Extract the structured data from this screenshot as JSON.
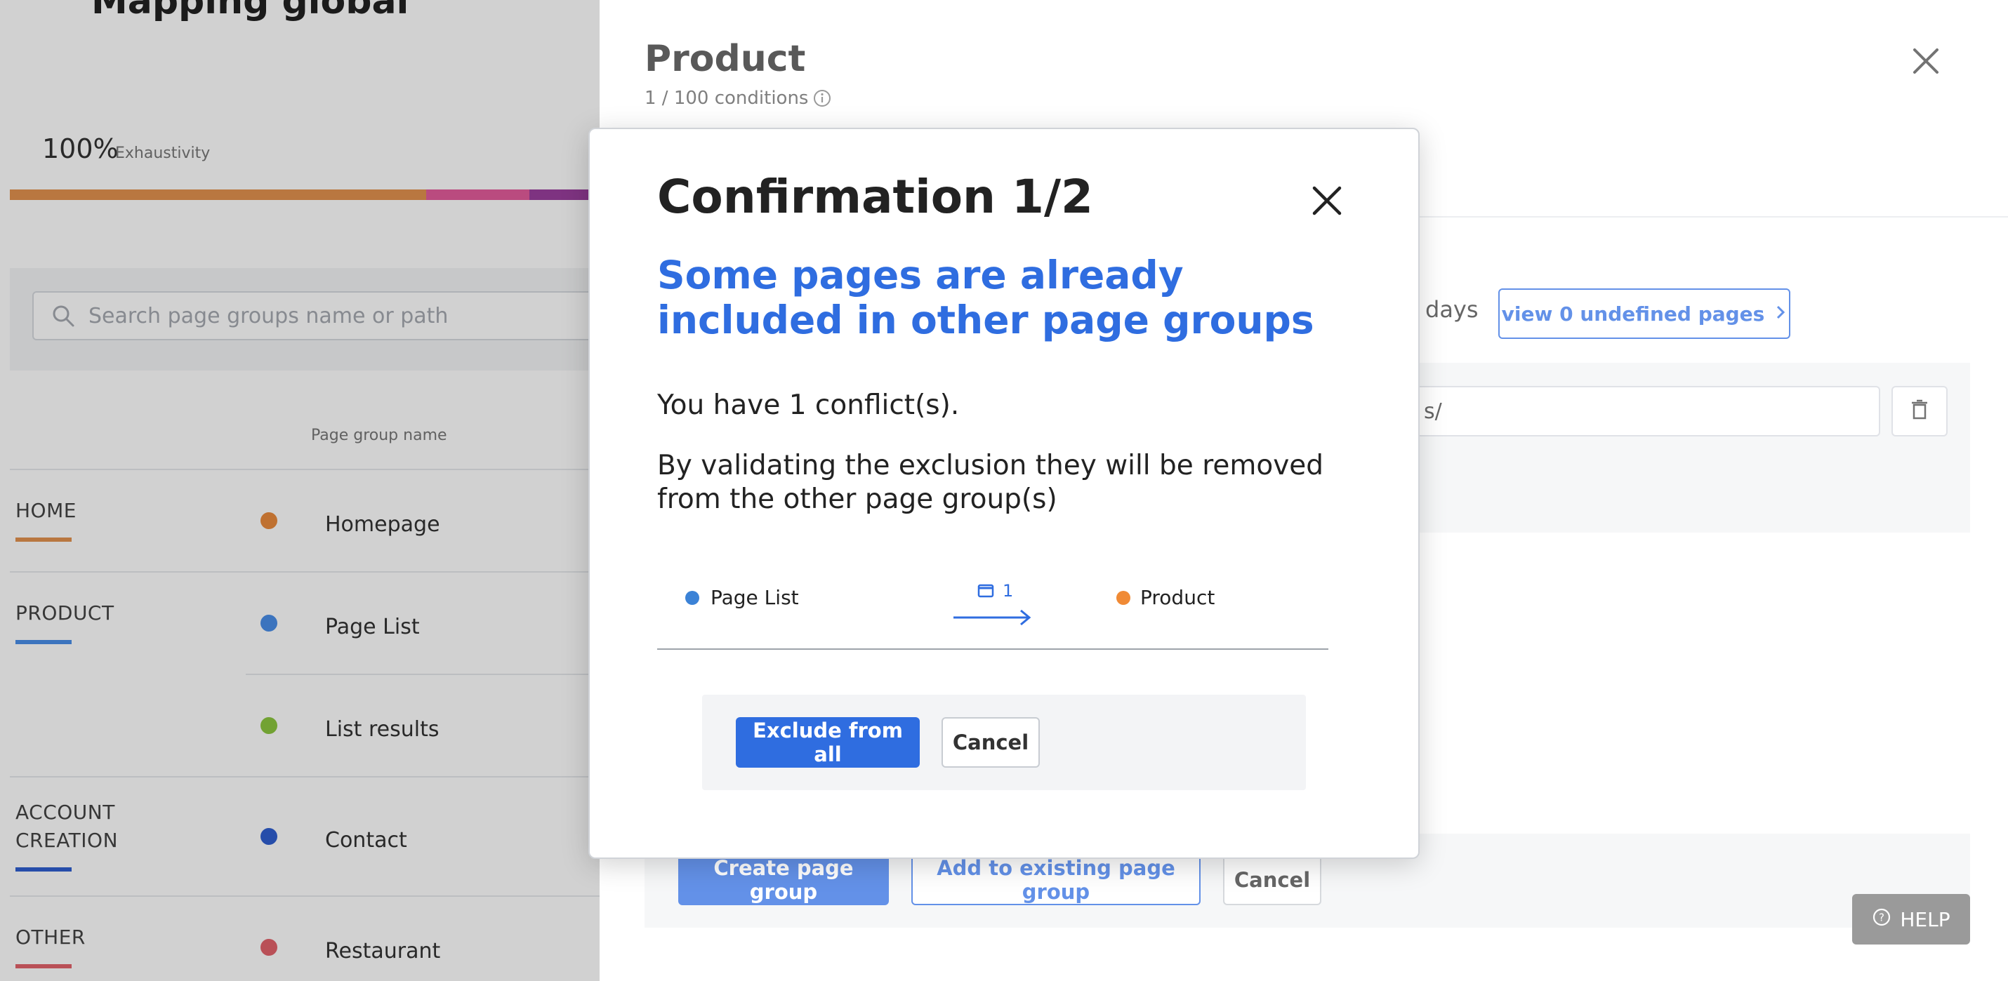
{
  "background_page": {
    "title": "Mapping global",
    "exhaustivity_value": "100%",
    "exhaustivity_label": "Exhaustivity",
    "exhaustivity_segments": [
      {
        "color": "#e2924f",
        "fraction": 0.69
      },
      {
        "color": "#e35c9b",
        "fraction": 0.17
      },
      {
        "color": "#9a3f9e",
        "fraction": 0.14
      }
    ],
    "search_placeholder": "Search page groups name or path",
    "column_header": "Page group name",
    "categories": [
      {
        "label": "HOME",
        "color": "#e2924f"
      },
      {
        "label": "PRODUCT",
        "color": "#4a8ee8"
      },
      {
        "label": "ACCOUNT\nCREATION",
        "color": "#2f5fd0"
      },
      {
        "label": "OTHER",
        "color": "#e2626b"
      }
    ],
    "page_groups": [
      {
        "name": "Homepage",
        "color": "#e98a3c"
      },
      {
        "name": "Page List",
        "color": "#4a8ee8"
      },
      {
        "name": "List results",
        "color": "#8cc63f"
      },
      {
        "name": "Contact",
        "color": "#2f5fd0"
      },
      {
        "name": "Restaurant",
        "color": "#e2626b"
      }
    ]
  },
  "drawer": {
    "title": "Product",
    "conditions": "1 / 100 conditions",
    "days_text": "days",
    "undefined_button": "view 0 undefined pages",
    "condition_value": "s/",
    "create_button": "Create page group",
    "add_existing_button": "Add to existing page group",
    "cancel_button": "Cancel"
  },
  "help_button": "HELP",
  "modal": {
    "title": "Confirmation 1/2",
    "subtitle": "Some pages are already included in other page groups",
    "conflicts": "You have 1 conflict(s).",
    "description": "By validating the exclusion they will be removed from the other page group(s)",
    "flow": {
      "from": "Page List",
      "from_color": "#3b82d6",
      "count": "1",
      "to": "Product",
      "to_color": "#f08a35"
    },
    "exclude_button": "Exclude from all",
    "cancel_button": "Cancel"
  }
}
